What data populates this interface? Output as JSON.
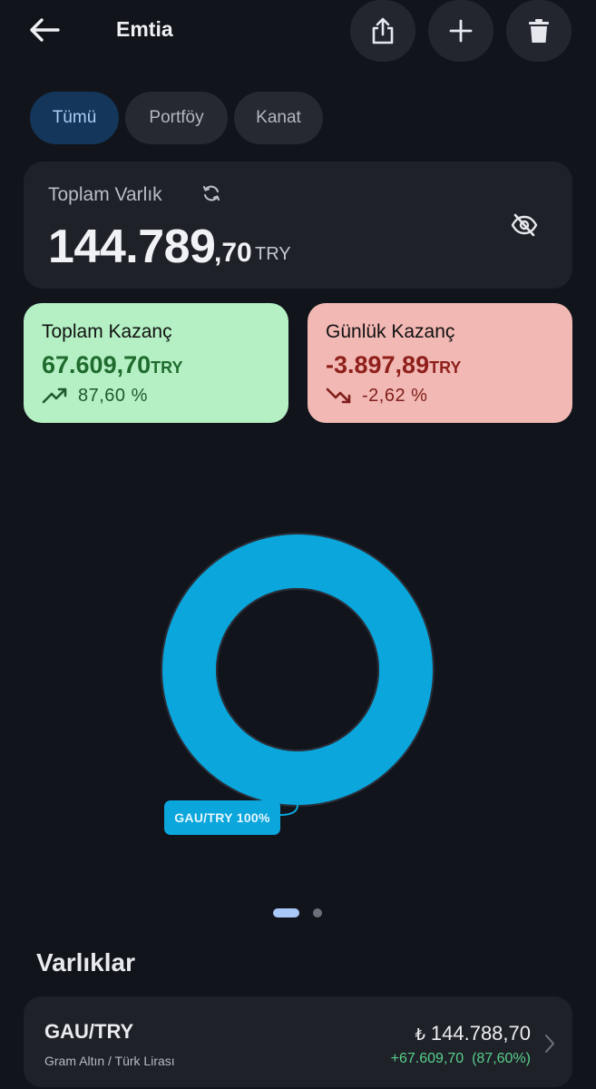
{
  "header": {
    "title": "Emtia",
    "back_icon": "arrow-left-icon",
    "actions": [
      "share-icon",
      "plus-icon",
      "trash-icon"
    ]
  },
  "filters": {
    "items": [
      {
        "label": "Tümü",
        "selected": true
      },
      {
        "label": "Portföy",
        "selected": false
      },
      {
        "label": "Kanat",
        "selected": false
      }
    ]
  },
  "total": {
    "label": "Toplam Varlık",
    "integer": "144.789",
    "decimal": ",70",
    "currency": "TRY"
  },
  "gains": {
    "total": {
      "title": "Toplam Kazanç",
      "value": "67.609,70",
      "currency": "TRY",
      "percent": "87,60 %"
    },
    "daily": {
      "title": "Günlük Kazanç",
      "value": "-3.897,89",
      "currency": "TRY",
      "percent": "-2,62 %"
    }
  },
  "chart_data": {
    "type": "pie",
    "categories": [
      "GAU/TRY"
    ],
    "values": [
      100
    ],
    "labels": [
      "GAU/TRY 100%"
    ],
    "colors": [
      "#0aa6dc"
    ]
  },
  "pager": {
    "count": 2,
    "active": 0
  },
  "assets": {
    "title": "Varlıklar",
    "items": [
      {
        "symbol": "GAU/TRY",
        "name": "Gram Altın / Türk Lirası",
        "currency_symbol": "₺",
        "price": "144.788,70",
        "gain": "+67.609,70  (87,60%)"
      }
    ]
  },
  "colors": {
    "background": "#12141b",
    "card": "#1f2129",
    "positive_card": "#b4f0c4",
    "negative_card": "#f2b8b4",
    "accent": "#0aa6dc",
    "positive_text": "#57d08a"
  }
}
